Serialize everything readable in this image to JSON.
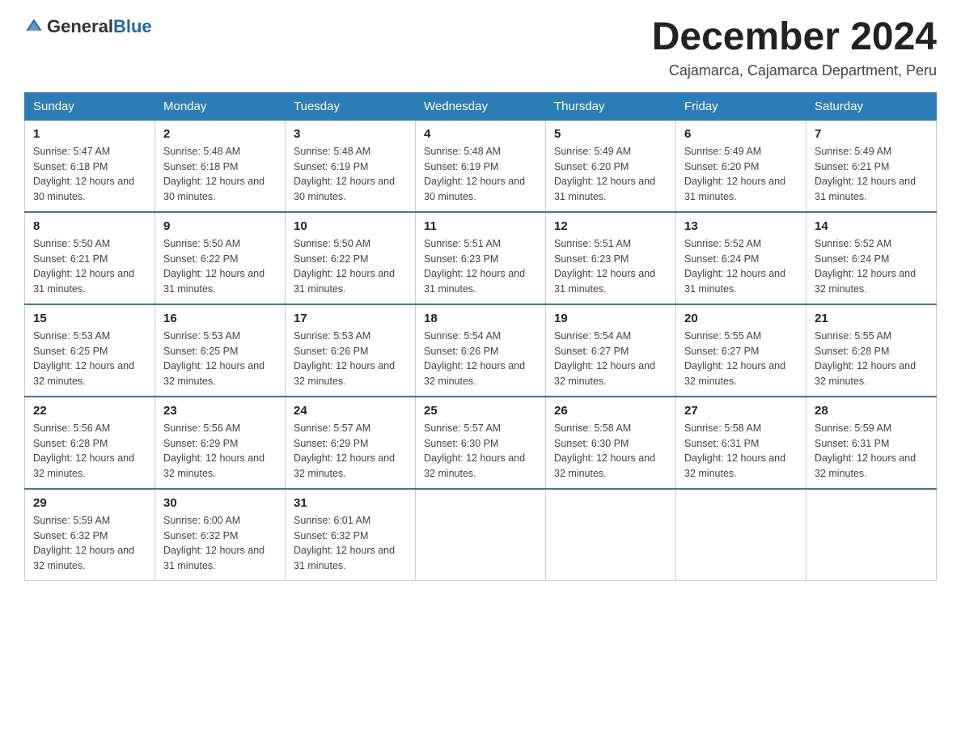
{
  "logo": {
    "text_general": "General",
    "text_blue": "Blue"
  },
  "title": "December 2024",
  "subtitle": "Cajamarca, Cajamarca Department, Peru",
  "days_of_week": [
    "Sunday",
    "Monday",
    "Tuesday",
    "Wednesday",
    "Thursday",
    "Friday",
    "Saturday"
  ],
  "weeks": [
    [
      {
        "day": "1",
        "sunrise": "5:47 AM",
        "sunset": "6:18 PM",
        "daylight": "12 hours and 30 minutes."
      },
      {
        "day": "2",
        "sunrise": "5:48 AM",
        "sunset": "6:18 PM",
        "daylight": "12 hours and 30 minutes."
      },
      {
        "day": "3",
        "sunrise": "5:48 AM",
        "sunset": "6:19 PM",
        "daylight": "12 hours and 30 minutes."
      },
      {
        "day": "4",
        "sunrise": "5:48 AM",
        "sunset": "6:19 PM",
        "daylight": "12 hours and 30 minutes."
      },
      {
        "day": "5",
        "sunrise": "5:49 AM",
        "sunset": "6:20 PM",
        "daylight": "12 hours and 31 minutes."
      },
      {
        "day": "6",
        "sunrise": "5:49 AM",
        "sunset": "6:20 PM",
        "daylight": "12 hours and 31 minutes."
      },
      {
        "day": "7",
        "sunrise": "5:49 AM",
        "sunset": "6:21 PM",
        "daylight": "12 hours and 31 minutes."
      }
    ],
    [
      {
        "day": "8",
        "sunrise": "5:50 AM",
        "sunset": "6:21 PM",
        "daylight": "12 hours and 31 minutes."
      },
      {
        "day": "9",
        "sunrise": "5:50 AM",
        "sunset": "6:22 PM",
        "daylight": "12 hours and 31 minutes."
      },
      {
        "day": "10",
        "sunrise": "5:50 AM",
        "sunset": "6:22 PM",
        "daylight": "12 hours and 31 minutes."
      },
      {
        "day": "11",
        "sunrise": "5:51 AM",
        "sunset": "6:23 PM",
        "daylight": "12 hours and 31 minutes."
      },
      {
        "day": "12",
        "sunrise": "5:51 AM",
        "sunset": "6:23 PM",
        "daylight": "12 hours and 31 minutes."
      },
      {
        "day": "13",
        "sunrise": "5:52 AM",
        "sunset": "6:24 PM",
        "daylight": "12 hours and 31 minutes."
      },
      {
        "day": "14",
        "sunrise": "5:52 AM",
        "sunset": "6:24 PM",
        "daylight": "12 hours and 32 minutes."
      }
    ],
    [
      {
        "day": "15",
        "sunrise": "5:53 AM",
        "sunset": "6:25 PM",
        "daylight": "12 hours and 32 minutes."
      },
      {
        "day": "16",
        "sunrise": "5:53 AM",
        "sunset": "6:25 PM",
        "daylight": "12 hours and 32 minutes."
      },
      {
        "day": "17",
        "sunrise": "5:53 AM",
        "sunset": "6:26 PM",
        "daylight": "12 hours and 32 minutes."
      },
      {
        "day": "18",
        "sunrise": "5:54 AM",
        "sunset": "6:26 PM",
        "daylight": "12 hours and 32 minutes."
      },
      {
        "day": "19",
        "sunrise": "5:54 AM",
        "sunset": "6:27 PM",
        "daylight": "12 hours and 32 minutes."
      },
      {
        "day": "20",
        "sunrise": "5:55 AM",
        "sunset": "6:27 PM",
        "daylight": "12 hours and 32 minutes."
      },
      {
        "day": "21",
        "sunrise": "5:55 AM",
        "sunset": "6:28 PM",
        "daylight": "12 hours and 32 minutes."
      }
    ],
    [
      {
        "day": "22",
        "sunrise": "5:56 AM",
        "sunset": "6:28 PM",
        "daylight": "12 hours and 32 minutes."
      },
      {
        "day": "23",
        "sunrise": "5:56 AM",
        "sunset": "6:29 PM",
        "daylight": "12 hours and 32 minutes."
      },
      {
        "day": "24",
        "sunrise": "5:57 AM",
        "sunset": "6:29 PM",
        "daylight": "12 hours and 32 minutes."
      },
      {
        "day": "25",
        "sunrise": "5:57 AM",
        "sunset": "6:30 PM",
        "daylight": "12 hours and 32 minutes."
      },
      {
        "day": "26",
        "sunrise": "5:58 AM",
        "sunset": "6:30 PM",
        "daylight": "12 hours and 32 minutes."
      },
      {
        "day": "27",
        "sunrise": "5:58 AM",
        "sunset": "6:31 PM",
        "daylight": "12 hours and 32 minutes."
      },
      {
        "day": "28",
        "sunrise": "5:59 AM",
        "sunset": "6:31 PM",
        "daylight": "12 hours and 32 minutes."
      }
    ],
    [
      {
        "day": "29",
        "sunrise": "5:59 AM",
        "sunset": "6:32 PM",
        "daylight": "12 hours and 32 minutes."
      },
      {
        "day": "30",
        "sunrise": "6:00 AM",
        "sunset": "6:32 PM",
        "daylight": "12 hours and 31 minutes."
      },
      {
        "day": "31",
        "sunrise": "6:01 AM",
        "sunset": "6:32 PM",
        "daylight": "12 hours and 31 minutes."
      },
      null,
      null,
      null,
      null
    ]
  ],
  "labels": {
    "sunrise": "Sunrise:",
    "sunset": "Sunset:",
    "daylight": "Daylight:"
  }
}
